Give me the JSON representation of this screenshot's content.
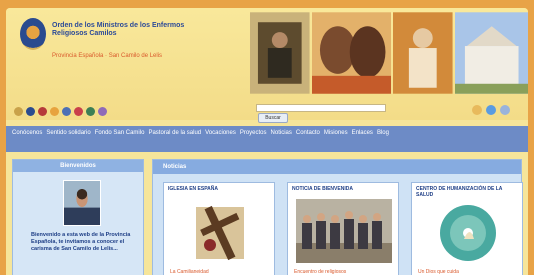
{
  "header": {
    "org_name": "Orden de los Ministros de los Enfermos Religiosos Camilos",
    "org_subtitle": "Provincia Española · San Camilo de Lelis",
    "logo_icon": "camillian-cross-logo-icon",
    "lang_flags": [
      "#c9a24a",
      "#2b4b8f",
      "#b63a3a",
      "#e7a33e",
      "#4c6fb5",
      "#c9404a",
      "#3d7f54",
      "#8f6ab8"
    ],
    "search": {
      "placeholder": "",
      "button_label": "Buscar"
    },
    "social": [
      {
        "name": "facebook-icon",
        "color": "#e8ba5c"
      },
      {
        "name": "twitter-icon",
        "color": "#5a9be0"
      },
      {
        "name": "rss-icon",
        "color": "#9ab3db"
      }
    ]
  },
  "nav": {
    "items": [
      "Conócenos",
      "Sentido solidario",
      "Fondo San Camilo",
      "Pastoral de la salud",
      "Vocaciones",
      "Proyectos",
      "Noticias",
      "Contacto",
      "Misiones",
      "Enlaces",
      "Blog"
    ]
  },
  "sidebar": {
    "title": "Bienvenidos",
    "welcome_text": "Bienvenido a esta web de la Provincia Española, te invitamos a conocer el carisma de San Camilo de Lelis..."
  },
  "main": {
    "title": "Noticias",
    "cards": [
      {
        "title": "IGLESIA EN ESPAÑA",
        "caption": "La Camilianeidad"
      },
      {
        "title": "NOTICIA DE BIENVENIDA",
        "caption": "Encuentro de religiosos"
      },
      {
        "title": "CENTRO DE HUMANIZACIÓN DE LA SALUD",
        "caption": "Un Dios que cuida"
      }
    ]
  }
}
